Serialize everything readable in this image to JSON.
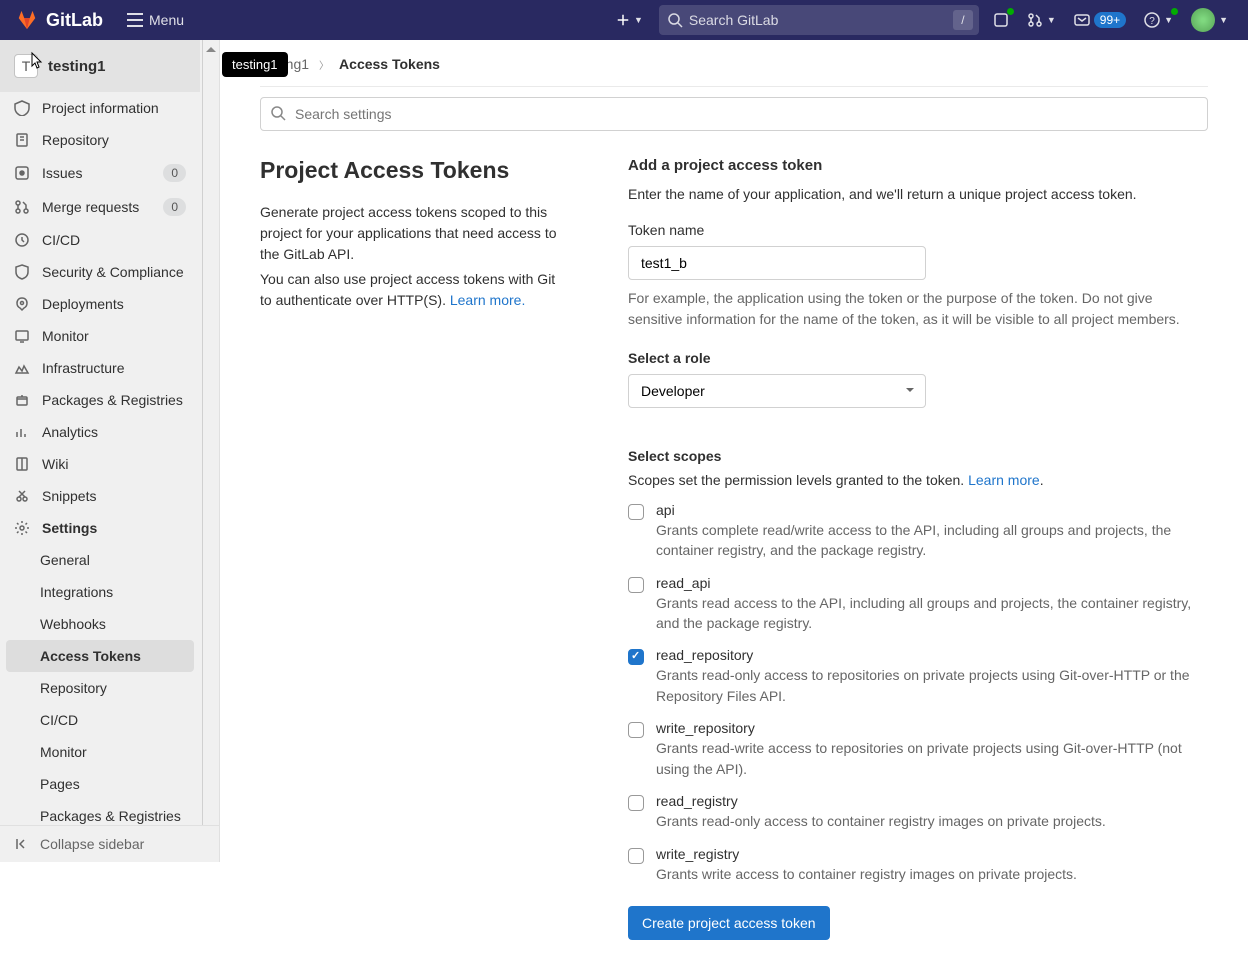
{
  "header": {
    "brand": "GitLab",
    "menu_label": "Menu",
    "search_placeholder": "Search GitLab",
    "slash": "/",
    "todo_badge": "99+"
  },
  "sidebar": {
    "project_letter": "T",
    "project_name": "testing1",
    "tooltip": "testing1",
    "items": [
      {
        "label": "Project information",
        "icon": "info"
      },
      {
        "label": "Repository",
        "icon": "repo"
      },
      {
        "label": "Issues",
        "icon": "issues",
        "count": "0"
      },
      {
        "label": "Merge requests",
        "icon": "mr",
        "count": "0"
      },
      {
        "label": "CI/CD",
        "icon": "cicd"
      },
      {
        "label": "Security & Compliance",
        "icon": "security"
      },
      {
        "label": "Deployments",
        "icon": "deploy"
      },
      {
        "label": "Monitor",
        "icon": "monitor"
      },
      {
        "label": "Infrastructure",
        "icon": "infra"
      },
      {
        "label": "Packages & Registries",
        "icon": "packages"
      },
      {
        "label": "Analytics",
        "icon": "analytics"
      },
      {
        "label": "Wiki",
        "icon": "wiki"
      },
      {
        "label": "Snippets",
        "icon": "snippets"
      },
      {
        "label": "Settings",
        "icon": "settings",
        "expanded": true
      }
    ],
    "subitems": [
      {
        "label": "General"
      },
      {
        "label": "Integrations"
      },
      {
        "label": "Webhooks"
      },
      {
        "label": "Access Tokens",
        "active": true
      },
      {
        "label": "Repository"
      },
      {
        "label": "CI/CD"
      },
      {
        "label": "Monitor"
      },
      {
        "label": "Pages"
      },
      {
        "label": "Packages & Registries"
      }
    ],
    "collapse_label": "Collapse sidebar"
  },
  "breadcrumb": {
    "project": "testing1",
    "current": "Access Tokens"
  },
  "search_settings_placeholder": "Search settings",
  "left": {
    "title": "Project Access Tokens",
    "p1": "Generate project access tokens scoped to this project for your applications that need access to the GitLab API.",
    "p2_a": "You can also use project access tokens with Git to authenticate over HTTP(S). ",
    "p2_link": "Learn more."
  },
  "form": {
    "heading": "Add a project access token",
    "intro": "Enter the name of your application, and we'll return a unique project access token.",
    "name_label": "Token name",
    "name_value": "test1_b",
    "name_help": "For example, the application using the token or the purpose of the token. Do not give sensitive information for the name of the token, as it will be visible to all project members.",
    "role_label": "Select a role",
    "role_value": "Developer",
    "scopes_label": "Select scopes",
    "scopes_desc": "Scopes set the permission levels granted to the token. ",
    "scopes_link": "Learn more",
    "scopes": [
      {
        "name": "api",
        "checked": false,
        "desc": "Grants complete read/write access to the API, including all groups and projects, the container registry, and the package registry."
      },
      {
        "name": "read_api",
        "checked": false,
        "desc": "Grants read access to the API, including all groups and projects, the container registry, and the package registry."
      },
      {
        "name": "read_repository",
        "checked": true,
        "desc": "Grants read-only access to repositories on private projects using Git-over-HTTP or the Repository Files API."
      },
      {
        "name": "write_repository",
        "checked": false,
        "desc": "Grants read-write access to repositories on private projects using Git-over-HTTP (not using the API)."
      },
      {
        "name": "read_registry",
        "checked": false,
        "desc": "Grants read-only access to container registry images on private projects."
      },
      {
        "name": "write_registry",
        "checked": false,
        "desc": "Grants write access to container registry images on private projects."
      }
    ],
    "submit": "Create project access token"
  }
}
